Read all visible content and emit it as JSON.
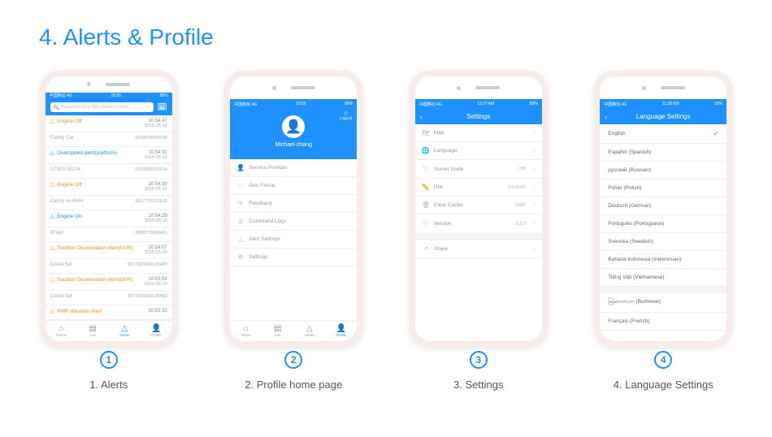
{
  "page_title": "4. Alerts & Profile",
  "captions": [
    "1. Alerts",
    "2. Profile home page",
    "3. Settings",
    "4. Language Settings"
  ],
  "statusbar": {
    "carrier": "中国移动 4G",
    "time": "10:55",
    "time2": "11:27 AM",
    "time3": "11:35 AM",
    "battery": "88%",
    "battery2": "93%"
  },
  "alerts_screen": {
    "search_placeholder": "Keywords (e.g.IMEI,Device name)",
    "rows": [
      {
        "type": "alert",
        "name": "Engine Off",
        "color": "orange",
        "time": "10:54:47",
        "date": "2019-05-10"
      },
      {
        "type": "device",
        "name": "Family Car",
        "sub": "3518008005234"
      },
      {
        "type": "alert",
        "name": "Overspeed alert(platform)",
        "color": "blue",
        "time": "10:54:32",
        "date": "2019-05-10"
      },
      {
        "type": "device",
        "name": "GT800-55214",
        "sub": "2510005000214"
      },
      {
        "type": "alert",
        "name": "Engine Off",
        "color": "orange",
        "time": "10:54:30",
        "date": "2019-05-10"
      },
      {
        "type": "device",
        "name": "Camry vs-4444",
        "sub": "3517770010528"
      },
      {
        "type": "alert",
        "name": "Engine On",
        "color": "blue",
        "time": "10:54:29",
        "date": "2019-05-10"
      },
      {
        "type": "device",
        "name": "5Ford",
        "sub": "3598570803491"
      },
      {
        "type": "alert",
        "name": "Sudden Deceleration Alert(DVR)",
        "color": "orange",
        "time": "10:54:07",
        "date": "2019-05-10"
      },
      {
        "type": "device",
        "name": "Coord Sul",
        "sub": "3577300090135483"
      },
      {
        "type": "alert",
        "name": "Sudden Deceleration Alert(DVR)",
        "color": "orange",
        "time": "10:53:54",
        "date": "2019-05-10"
      },
      {
        "type": "device",
        "name": "Coord Sul",
        "sub": "3577300090135483"
      },
      {
        "type": "alert",
        "name": "PNR vibration Alert",
        "color": "orange",
        "time": "10:53:33",
        "date": ""
      }
    ],
    "tabs": [
      "Home",
      "List",
      "Alerts",
      "Profile"
    ]
  },
  "profile_screen": {
    "logout": "Logout",
    "username": "Michael-zhang",
    "items": [
      {
        "icon": "👤",
        "label": "Service Provider"
      },
      {
        "icon": "⬚",
        "label": "Geo Fence"
      },
      {
        "icon": "✎",
        "label": "Feedback"
      },
      {
        "icon": "≣",
        "label": "Command Logs"
      },
      {
        "icon": "△",
        "label": "Alert Settings"
      },
      {
        "icon": "⚙",
        "label": "Settings"
      }
    ]
  },
  "settings_screen": {
    "title": "Settings",
    "items": [
      {
        "icon": "🗺",
        "label": "Map",
        "val": ""
      },
      {
        "icon": "🌐",
        "label": "Language",
        "val": ""
      },
      {
        "icon": "⎋",
        "label": "Server Node",
        "val": "HK"
      },
      {
        "icon": "📏",
        "label": "Unit",
        "val": "km,km/h"
      },
      {
        "icon": "🗑",
        "label": "Clear Cache",
        "val": "166K"
      },
      {
        "icon": "ⓘ",
        "label": "Version",
        "val": "3.2.3"
      },
      {
        "icon": "↗",
        "label": "Share",
        "val": ""
      }
    ]
  },
  "language_screen": {
    "title": "Language Settings",
    "langs": [
      {
        "label": "English",
        "selected": true
      },
      {
        "label": "Español (Spanish)"
      },
      {
        "label": "русский (Russian)"
      },
      {
        "label": "Polski (Polish)"
      },
      {
        "label": "Deutsch (German)"
      },
      {
        "label": "Português (Portuguese)"
      },
      {
        "label": "Svenska (Swedish)"
      },
      {
        "label": "Bahasa Indonesia (Indonesian)"
      },
      {
        "label": "Tiếng Việt (Vietnamese)"
      },
      {
        "label": "မြန်မာဘာသာ (Burmese)"
      },
      {
        "label": "Français (French)"
      }
    ]
  }
}
